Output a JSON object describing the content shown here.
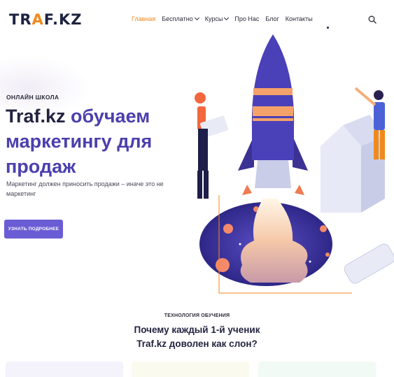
{
  "header": {
    "logo": {
      "part1": "TR",
      "accent": "A",
      "part2": "F.KZ"
    },
    "nav": [
      {
        "label": "Главная",
        "active": true,
        "dropdown": false
      },
      {
        "label": "Бесплатно",
        "active": false,
        "dropdown": true
      },
      {
        "label": "Курсы",
        "active": false,
        "dropdown": true
      },
      {
        "label": "Про Нас",
        "active": false,
        "dropdown": false
      },
      {
        "label": "Блог",
        "active": false,
        "dropdown": false
      },
      {
        "label": "Контакты",
        "active": false,
        "dropdown": false
      }
    ],
    "search_icon": "search-icon"
  },
  "hero": {
    "eyebrow": "ОНЛАЙН ШКОЛА",
    "title_dark": "Traf.kz",
    "title_rest": " обучаем маркетингу для продаж",
    "subtitle": "Маркетинг должен приносить продажи – иначе это не маркетинг",
    "cta_label": "УЗНАТЬ ПОДРОБНЕЕ"
  },
  "section": {
    "eyebrow": "ТЕХНОЛОГИЯ ОБУЧЕНИЯ",
    "title_line1": "Почему каждый 1-й ученик",
    "title_line2": "Traf.kz доволен как слон?"
  },
  "colors": {
    "accent_orange": "#f08a1c",
    "brand_purple": "#4b3fae",
    "button_purple": "#6a5cd4",
    "dark_text": "#232340"
  }
}
